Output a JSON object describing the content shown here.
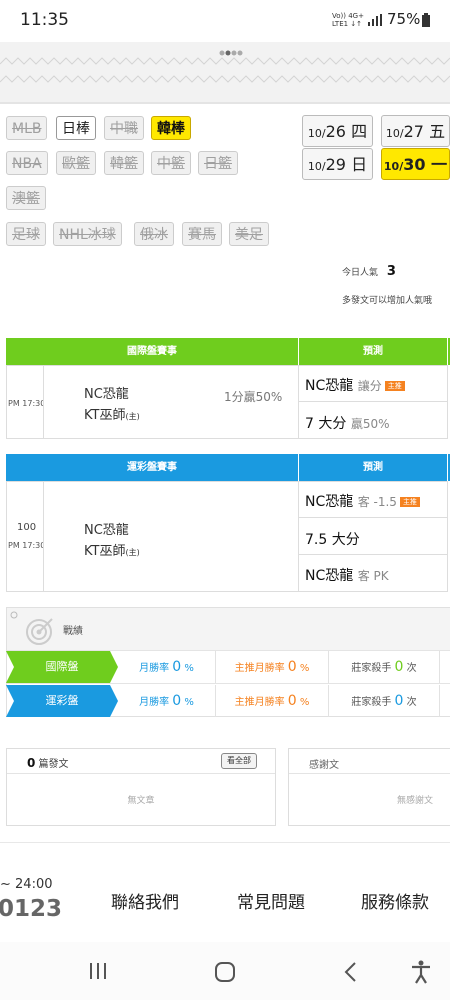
{
  "status_bar": {
    "time": "11:35",
    "network_top": "Vo))  4G+",
    "network_bottom": "LTE1  ↓↑",
    "battery": "75%"
  },
  "sports": {
    "row1": [
      {
        "label": "MLB",
        "state": "disabled"
      },
      {
        "label": "日棒",
        "state": "active"
      },
      {
        "label": "中職",
        "state": "disabled"
      },
      {
        "label": "韓棒",
        "state": "selected"
      }
    ],
    "row2": [
      {
        "label": "NBA",
        "state": "disabled"
      },
      {
        "label": "歐籃",
        "state": "disabled"
      },
      {
        "label": "韓籃",
        "state": "disabled"
      },
      {
        "label": "中籃",
        "state": "disabled"
      },
      {
        "label": "日籃",
        "state": "disabled"
      }
    ],
    "row3": [
      {
        "label": "澳籃",
        "state": "disabled"
      }
    ],
    "row4": [
      {
        "label": "足球",
        "state": "disabled"
      },
      {
        "label": "NHL冰球",
        "state": "disabled"
      },
      {
        "label": "俄冰",
        "state": "disabled"
      },
      {
        "label": "賽馬",
        "state": "disabled"
      },
      {
        "label": "美足",
        "state": "disabled"
      }
    ]
  },
  "dates": [
    {
      "month": "10/",
      "day": "26 四",
      "state": "normal"
    },
    {
      "month": "10/",
      "day": "27 五",
      "state": "normal"
    },
    {
      "month": "10/",
      "day": "29 日",
      "state": "normal"
    },
    {
      "month": "10/",
      "day": "30 一",
      "state": "selected"
    }
  ],
  "popularity": {
    "label": "今日人氣",
    "value": "3",
    "hint": "多發文可以增加人氣哦"
  },
  "intl": {
    "header": "國際盤賽事",
    "pred_header": "預測",
    "time": "PM 17:30",
    "away": "NC恐龍",
    "home": "KT巫師",
    "home_tag": "(主)",
    "odds": "1分贏50%",
    "pred1_team": "NC恐龍",
    "pred1_note": "讓分",
    "pred1_tag": "主推",
    "pred2_main": "7 大分",
    "pred2_note": "贏50%"
  },
  "lottery": {
    "header": "運彩盤賽事",
    "pred_header": "預測",
    "number": "100",
    "time": "PM 17:30",
    "away": "NC恐龍",
    "home": "KT巫師",
    "home_tag": "(主)",
    "pred1_team": "NC恐龍",
    "pred1_note": "客 -1.5",
    "pred1_tag": "主推",
    "pred2_main": "7.5 大分",
    "pred3_team": "NC恐龍",
    "pred3_note": "客 PK"
  },
  "record": {
    "title": "戰績",
    "rows": [
      {
        "label": "國際盤",
        "color": "#6fcd1e",
        "monthly_label": "月勝率",
        "monthly": "0",
        "pct": "%",
        "main_label": "主推月勝率",
        "main": "0",
        "killer_label": "莊家殺手",
        "killer": "0",
        "unit": "次"
      },
      {
        "label": "運彩盤",
        "color": "#1a9ae0",
        "monthly_label": "月勝率",
        "monthly": "0",
        "pct": "%",
        "main_label": "主推月勝率",
        "main": "0",
        "killer_label": "莊家殺手",
        "killer": "0",
        "unit": "次"
      }
    ]
  },
  "posts": {
    "count": "0",
    "label": "篇發文",
    "view_all": "看全部",
    "empty": "無文章"
  },
  "thanks": {
    "label": "感謝文",
    "empty": "無感謝文"
  },
  "footer": {
    "hours": "~ 24:00",
    "phone": "0123",
    "contact": "聯絡我們",
    "faq": "常見問題",
    "terms": "服務條款"
  },
  "colors": {
    "green": "#6fcd1e",
    "blue": "#1a9ae0",
    "yellow": "#ffe800",
    "orange": "#f58220"
  }
}
